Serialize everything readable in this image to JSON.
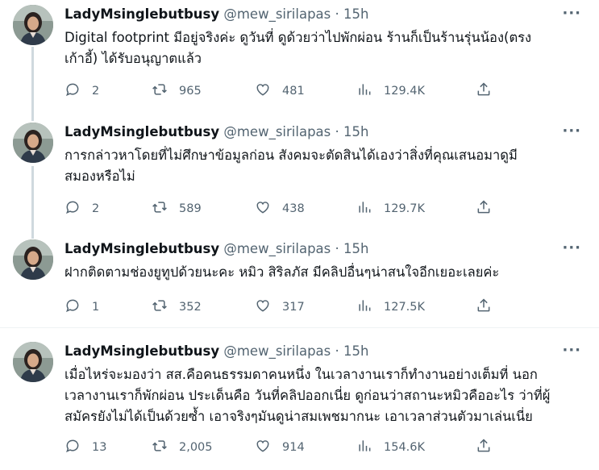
{
  "tweets": [
    {
      "display_name": "LadyMsinglebutbusy",
      "handle": "@mew_sirilapas",
      "dot": "·",
      "time": "15h",
      "lines": [
        "Digital footprint มีอยู่จริงค่ะ ดูวันที่ ดูด้วยว่าไปพักผ่อน ร้านก็เป็นร้านรุ่นน้อง(ตรง",
        "เก้าอี้) ได้รับอนุญาตแล้ว"
      ],
      "replies": "2",
      "retweets": "965",
      "likes": "481",
      "views": "129.4K"
    },
    {
      "display_name": "LadyMsinglebutbusy",
      "handle": "@mew_sirilapas",
      "dot": "·",
      "time": "15h",
      "lines": [
        "การกล่าวหาโดยที่ไม่ศึกษาข้อมูลก่อน สังคมจะตัดสินได้เองว่าสิ่งที่คุณเสนอมาดูมี",
        "สมองหรือไม่"
      ],
      "replies": "2",
      "retweets": "589",
      "likes": "438",
      "views": "129.7K"
    },
    {
      "display_name": "LadyMsinglebutbusy",
      "handle": "@mew_sirilapas",
      "dot": "·",
      "time": "15h",
      "lines": [
        "ฝากติดตามช่องยูทูปด้วยนะคะ หมิว สิริลภัส มีคลิปอื่นๆน่าสนใจอีกเยอะเลยค่ะ"
      ],
      "replies": "1",
      "retweets": "352",
      "likes": "317",
      "views": "127.5K"
    },
    {
      "display_name": "LadyMsinglebutbusy",
      "handle": "@mew_sirilapas",
      "dot": "·",
      "time": "15h",
      "lines": [
        "เมื่อไหร่จะมองว่า สส.คือคนธรรมดาคนหนึ่ง ในเวลางานเราก็ทำงานอย่างเต็มที่ นอก",
        "เวลางานเราก็พักผ่อน ประเด็นคือ วันที่คลิปออกเนี่ย ดูก่อนว่าสถานะหมิวคืออะไร ว่าที่ผู้",
        "สมัครยังไม่ได้เป็นด้วยซ้ำ เอาจริงๆมันดูน่าสมเพชมากนะ เอาเวลาส่วนตัวมาเล่นเนี่ย"
      ],
      "replies": "13",
      "retweets": "2,005",
      "likes": "914",
      "views": "154.6K"
    }
  ],
  "icons": {
    "reply": "reply-icon",
    "retweet": "retweet-icon",
    "like": "heart-icon",
    "views": "views-icon",
    "share": "share-icon",
    "more": "more-icon"
  },
  "more_glyph": "···"
}
